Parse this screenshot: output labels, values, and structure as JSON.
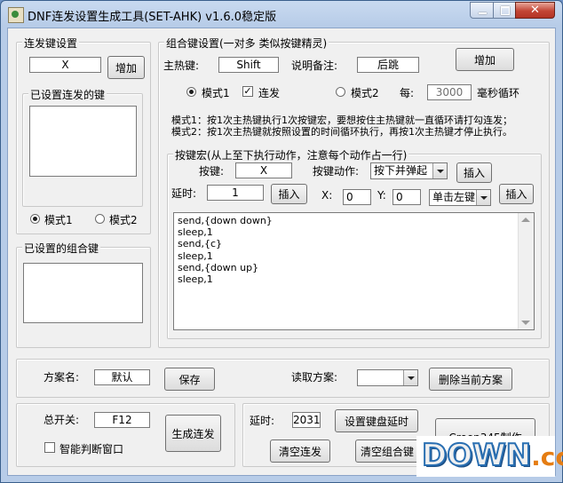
{
  "window": {
    "title": "DNF连发设置生成工具(SET-AHK) v1.6.0稳定版"
  },
  "repeat_group": {
    "title": "连发键设置",
    "key_value": "X",
    "add_label": "增加",
    "list_title": "已设置连发的键",
    "mode1_label": "模式1",
    "mode2_label": "模式2",
    "selected_mode": "mode1"
  },
  "combo_list": {
    "title": "已设置的组合键"
  },
  "combo_group": {
    "title": "组合键设置(一对多 类似按键精灵)",
    "hotkey_label": "主热键:",
    "hotkey_value": "Shift",
    "note_label": "说明备注:",
    "note_value": "后跳",
    "add_label": "增加",
    "mode1_label": "模式1",
    "repeat_label": "连发",
    "repeat_checked": true,
    "mode2_label": "模式2",
    "every_label": "每:",
    "interval_value": "3000",
    "interval_unit": "毫秒循环",
    "desc1": "模式1：按1次主热键执行1次按键宏，要想按住主热键就一直循环请打勾连发；",
    "desc2": "模式2：按1次主热键就按照设置的时间循环执行，再按1次主热键才停止执行。"
  },
  "macro_group": {
    "title": "按键宏(从上至下执行动作，注意每个动作占一行)",
    "key_label": "按键:",
    "key_value": "X",
    "action_label": "按键动作:",
    "action_value": "按下并弹起",
    "insert1_label": "插入",
    "delay_label": "延时:",
    "delay_value": "1",
    "insert2_label": "插入",
    "x_label": "X:",
    "x_value": "0",
    "y_label": "Y:",
    "y_value": "0",
    "click_value": "单击左键",
    "insert3_label": "插入",
    "lines": [
      "send,{down down}",
      "sleep,1",
      "send,{c}",
      "sleep,1",
      "send,{down up}",
      "sleep,1"
    ]
  },
  "scheme": {
    "name_label": "方案名:",
    "name_value": "默认",
    "save_label": "保存",
    "load_label": "读取方案:",
    "load_value": "",
    "delete_label": "删除当前方案"
  },
  "master": {
    "switch_label": "总开关:",
    "switch_value": "F12",
    "smart_label": "智能判断窗口",
    "smart_checked": false,
    "generate_label": "生成连发"
  },
  "bottom_right": {
    "delay_label": "延时:",
    "delay_value": "2031",
    "set_delay_label": "设置键盘延时",
    "clear_repeat_label": "清空连发",
    "clear_combo_label": "清空组合键",
    "author_label": "Creep345制作"
  },
  "watermark": {
    "main": "DOWN",
    "tld": ".cc"
  }
}
